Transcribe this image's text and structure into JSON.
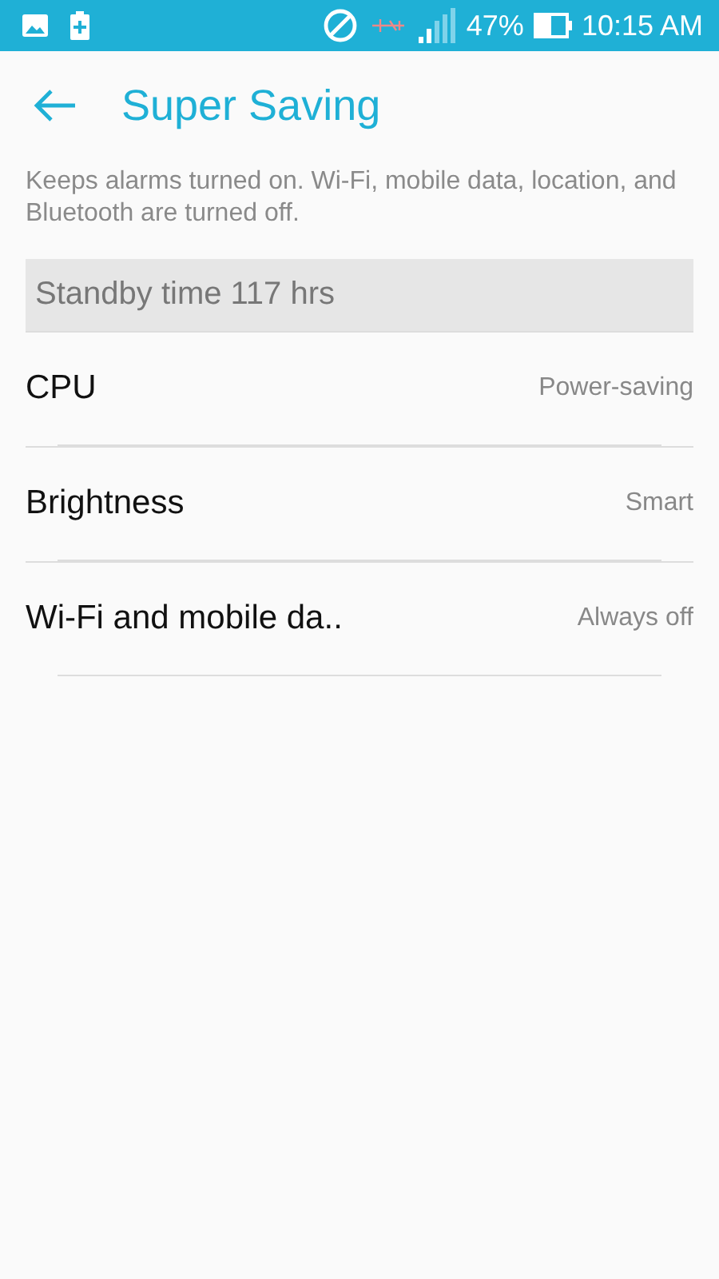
{
  "status_bar": {
    "battery": "47%",
    "time": "10:15 AM"
  },
  "header": {
    "title": "Super Saving"
  },
  "description": "Keeps alarms turned on. Wi-Fi, mobile data, location, and Bluetooth are turned off.",
  "standby": "Standby time 117 hrs",
  "settings": [
    {
      "label": "CPU",
      "value": "Power-saving"
    },
    {
      "label": "Brightness",
      "value": "Smart"
    },
    {
      "label": "Wi-Fi and mobile da..",
      "value": "Always off"
    }
  ]
}
